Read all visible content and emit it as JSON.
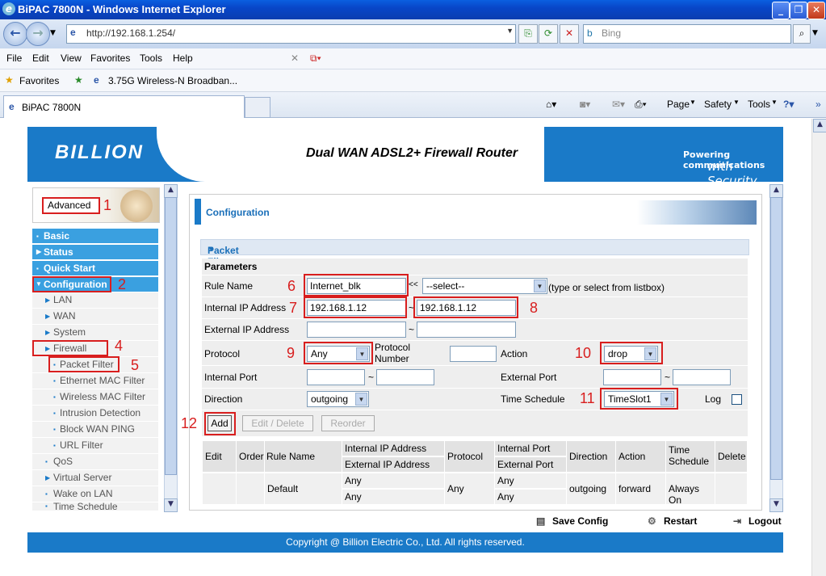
{
  "window": {
    "title": "BiPAC 7800N - Windows Internet Explorer"
  },
  "browser": {
    "address": "http://192.168.1.254/",
    "search_placeholder": "Bing",
    "menu": [
      "File",
      "Edit",
      "View",
      "Favorites",
      "Tools",
      "Help"
    ],
    "favorites_label": "Favorites",
    "favorite_link": "3.75G Wireless-N Broadban...",
    "tab_title": "BiPAC 7800N",
    "commands": [
      "Page",
      "Safety",
      "Tools"
    ]
  },
  "header": {
    "logo": "BILLION",
    "product": "Dual WAN ADSL2+ Firewall Router",
    "tagline_top": "Powering communications",
    "tagline_bottom": "with Security"
  },
  "sidebar": {
    "mode_label": "Advanced",
    "sections": {
      "basic": "Basic",
      "status": "Status",
      "quick_start": "Quick Start",
      "configuration": "Configuration"
    },
    "items": {
      "lan": "LAN",
      "wan": "WAN",
      "system": "System",
      "firewall": "Firewall",
      "packet_filter": "Packet Filter",
      "ethernet_mac_filter": "Ethernet MAC Filter",
      "wireless_mac_filter": "Wireless MAC Filter",
      "intrusion_detection": "Intrusion Detection",
      "block_wan_ping": "Block WAN PING",
      "url_filter": "URL Filter",
      "qos": "QoS",
      "virtual_server": "Virtual Server",
      "wake_on_lan": "Wake on LAN",
      "time_schedule": "Time Schedule"
    }
  },
  "main": {
    "title": "Configuration",
    "section_title": "Packet Filter",
    "params_title": "Parameters",
    "labels": {
      "rule_name": "Rule Name",
      "internal_ip": "Internal IP Address",
      "external_ip": "External IP Address",
      "protocol": "Protocol",
      "protocol_number": "Protocol Number",
      "action": "Action",
      "internal_port": "Internal Port",
      "external_port": "External Port",
      "direction": "Direction",
      "time_schedule": "Time Schedule",
      "log": "Log",
      "listbox_hint": "(type or select from listbox)",
      "range_sep": "~",
      "double_lt": "<<"
    },
    "values": {
      "rule_name": "Internet_blk",
      "rule_select": "--select--",
      "internal_ip_start": "192.168.1.12",
      "internal_ip_end": "192.168.1.12",
      "external_ip_start": "",
      "external_ip_end": "",
      "protocol": "Any",
      "protocol_number": "",
      "action": "drop",
      "internal_port_start": "",
      "internal_port_end": "",
      "external_port_start": "",
      "external_port_end": "",
      "direction": "outgoing",
      "time_schedule": "TimeSlot1",
      "log_checked": false
    },
    "buttons": {
      "add": "Add",
      "edit_delete": "Edit / Delete",
      "reorder": "Reorder"
    },
    "table": {
      "headers": {
        "edit": "Edit",
        "order": "Order",
        "rule_name": "Rule Name",
        "internal_ip": "Internal IP Address",
        "external_ip": "External IP Address",
        "protocol": "Protocol",
        "internal_port": "Internal Port",
        "external_port": "External Port",
        "direction": "Direction",
        "action": "Action",
        "time_schedule": "Time Schedule",
        "delete": "Delete"
      },
      "row": {
        "rule_name": "Default",
        "internal_ip": "Any",
        "external_ip": "Any",
        "protocol": "Any",
        "internal_port": "Any",
        "external_port": "Any",
        "direction": "outgoing",
        "action": "forward",
        "time_schedule": "Always On"
      }
    }
  },
  "annotations": [
    "1",
    "2",
    "4",
    "5",
    "6",
    "7",
    "8",
    "9",
    "10",
    "11",
    "12"
  ],
  "footer": {
    "save_config": "Save Config",
    "restart": "Restart",
    "logout": "Logout",
    "copyright": "Copyright @ Billion Electric Co., Ltd. All rights reserved."
  }
}
